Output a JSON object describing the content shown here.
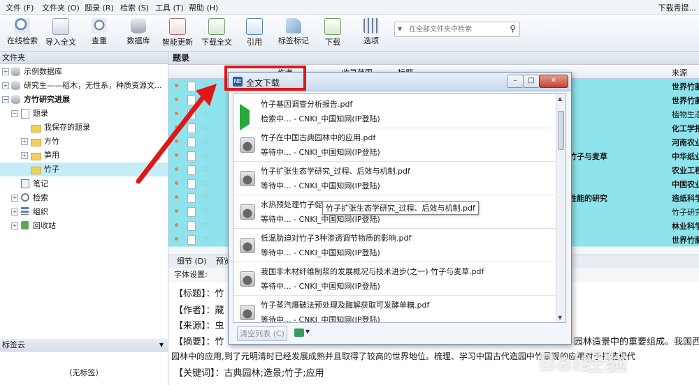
{
  "menu": [
    "文件 (F)",
    "文件夹 (O)",
    "题录 (R)",
    "检索 (S)",
    "工具 (T)",
    "帮助 (H)"
  ],
  "app_title": "下载青提...",
  "toolbar": [
    "在线检索",
    "导入全文",
    "查重",
    "数据库",
    "智能更新",
    "下载全文",
    "引用",
    "标签标记",
    "下载",
    "选项"
  ],
  "search_placeholder": "在全部文件夹中检索",
  "left": {
    "header": "文件夹",
    "tree": [
      "示例数据库",
      "研究生——稻木，无性系，种质资源文...",
      "方竹研究进展",
      "题录",
      "我保存的题录",
      "方竹",
      "笋用",
      "竹子",
      "笔记",
      "检索",
      "组织",
      "回收站"
    ],
    "tagcloud_header": "标签云",
    "tagcloud_empty": "（无标签）"
  },
  "list": {
    "header": "题录",
    "columns": [
      "作者",
      "收录范围",
      "标题",
      "来源"
    ],
    "sources": [
      "世界竹藤",
      "世界竹藤",
      "植物生态",
      "化工学报",
      "河南农业",
      "中华纸业",
      "农业工程",
      "中国农业",
      "造纸科学",
      "竹子研究",
      "林业科学",
      "世界竹藤"
    ],
    "title_fragments": [
      {
        "row": 5,
        "text": "竹子与麦草"
      },
      {
        "row": 8,
        "text": "性能的研究"
      }
    ]
  },
  "detail": {
    "tabs": [
      "细节 (D)",
      "预览"
    ],
    "font_label": "字体设置:",
    "lines": [
      "【标题】：竹",
      "【作者】：藏",
      "【来源】：虫",
      "【摘要】：竹",
      "园林中的应用,到了元明清时已经发展成熟并且取得了较高的世界地位。梳理、学习中国古代造园中竹景观的应用对于打造现代",
      "【关键词】：古典园林;造景;竹子;应用"
    ],
    "right_fragment": "园林造景中的重要组成。我国西"
  },
  "dialog": {
    "title": "全文下载",
    "items": [
      {
        "name": "竹子基因调查分析报告.pdf",
        "status": "检索中...   -  CNKI_中国知网(IP登陆)",
        "state": "active"
      },
      {
        "name": "竹子在中国古典园林中的应用.pdf",
        "status": "等待中...   -  CNKI_中国知网(IP登陆)",
        "state": "waiting"
      },
      {
        "name": "竹子扩张生态学研究_过程、后效与机制.pdf",
        "status": "等待中...   -  CNKI_中国知网(IP登陆)",
        "state": "waiting"
      },
      {
        "name": "水热预处理竹子促",
        "status": "等待中...   -  CNKI_中国知网(IP登陆)",
        "state": "waiting"
      },
      {
        "name": "低温肋迫对竹子3种渗透调节物质的影响.pdf",
        "status": "等待中...   -  CNKI_中国知网(IP登陆)",
        "state": "waiting"
      },
      {
        "name": "我国非木材纤维制浆的发展概况与技术进步(之一)  竹子与麦草.pdf",
        "status": "等待中...   -  CNKI_中国知网(IP登陆)",
        "state": "waiting"
      },
      {
        "name": "竹子蒸汽爆破法预处理及酶解获取可发酵单糖.pdf",
        "status": "等待中...   -  CNKI_中国知网(IP登陆)",
        "state": "waiting"
      }
    ],
    "tooltip": "竹子扩张生态学研究_过程、后效与机制.pdf",
    "clear_button": "清空列表 (C)"
  },
  "watermark": "Bai经验"
}
